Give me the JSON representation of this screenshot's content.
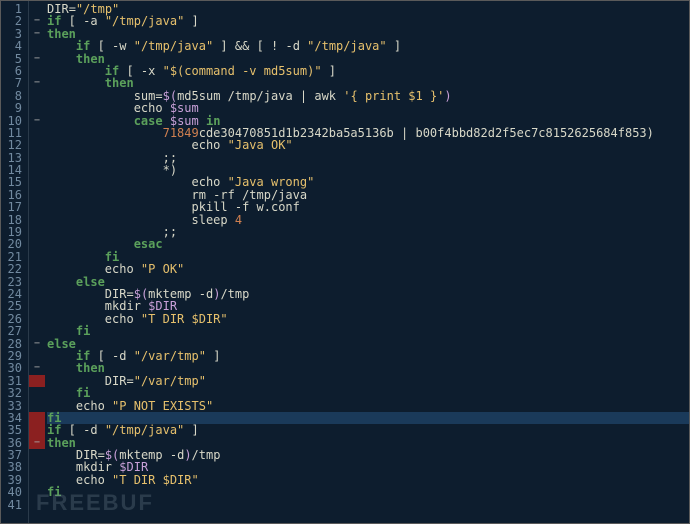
{
  "watermark": "FREEBUF",
  "lines": [
    {
      "n": 1,
      "f": "",
      "cls": "",
      "tokens": [
        {
          "c": "s-var",
          "t": "DIR"
        },
        {
          "c": "s-op",
          "t": "="
        },
        {
          "c": "s-str",
          "t": "\"/tmp\""
        }
      ]
    },
    {
      "n": 2,
      "f": "-",
      "cls": "",
      "tokens": [
        {
          "c": "s-greenkw",
          "t": "if"
        },
        {
          "c": "s-op",
          "t": " [ "
        },
        {
          "c": "s-op",
          "t": "-a "
        },
        {
          "c": "s-str",
          "t": "\"/tmp/java\""
        },
        {
          "c": "s-op",
          "t": " ]"
        }
      ]
    },
    {
      "n": 3,
      "f": "-",
      "cls": "",
      "tokens": [
        {
          "c": "s-greenkw",
          "t": "then"
        }
      ]
    },
    {
      "n": 4,
      "f": "",
      "cls": "",
      "tokens": [
        {
          "c": "s-op",
          "t": "    "
        },
        {
          "c": "s-greenkw",
          "t": "if"
        },
        {
          "c": "s-op",
          "t": " [ -w "
        },
        {
          "c": "s-str",
          "t": "\"/tmp/java\""
        },
        {
          "c": "s-op",
          "t": " ] "
        },
        {
          "c": "s-op",
          "t": "&& "
        },
        {
          "c": "s-op",
          "t": "[ ! -d "
        },
        {
          "c": "s-str",
          "t": "\"/tmp/java\""
        },
        {
          "c": "s-op",
          "t": " ]"
        }
      ]
    },
    {
      "n": 5,
      "f": "-",
      "cls": "",
      "tokens": [
        {
          "c": "s-op",
          "t": "    "
        },
        {
          "c": "s-greenkw",
          "t": "then"
        }
      ]
    },
    {
      "n": 6,
      "f": "",
      "cls": "",
      "tokens": [
        {
          "c": "s-op",
          "t": "        "
        },
        {
          "c": "s-greenkw",
          "t": "if"
        },
        {
          "c": "s-op",
          "t": " [ -x "
        },
        {
          "c": "s-str",
          "t": "\"$(command -v md5sum)\""
        },
        {
          "c": "s-op",
          "t": " ]"
        }
      ]
    },
    {
      "n": 7,
      "f": "-",
      "cls": "",
      "tokens": [
        {
          "c": "s-op",
          "t": "        "
        },
        {
          "c": "s-greenkw",
          "t": "then"
        }
      ]
    },
    {
      "n": 8,
      "f": "",
      "cls": "",
      "tokens": [
        {
          "c": "s-op",
          "t": "            "
        },
        {
          "c": "s-var",
          "t": "sum"
        },
        {
          "c": "s-op",
          "t": "="
        },
        {
          "c": "s-dollar",
          "t": "$("
        },
        {
          "c": "s-cmd",
          "t": "md5sum /tmp/java "
        },
        {
          "c": "s-op",
          "t": "| "
        },
        {
          "c": "s-cmd",
          "t": "awk "
        },
        {
          "c": "s-str",
          "t": "'{ print $1 }'"
        },
        {
          "c": "s-dollar",
          "t": ")"
        }
      ]
    },
    {
      "n": 9,
      "f": "",
      "cls": "",
      "tokens": [
        {
          "c": "s-op",
          "t": "            "
        },
        {
          "c": "s-cmd",
          "t": "echo "
        },
        {
          "c": "s-dollar",
          "t": "$sum"
        }
      ]
    },
    {
      "n": 10,
      "f": "-",
      "cls": "",
      "tokens": [
        {
          "c": "s-op",
          "t": "            "
        },
        {
          "c": "s-greenkw",
          "t": "case"
        },
        {
          "c": "s-op",
          "t": " "
        },
        {
          "c": "s-dollar",
          "t": "$sum"
        },
        {
          "c": "s-op",
          "t": " "
        },
        {
          "c": "s-greenkw",
          "t": "in"
        }
      ]
    },
    {
      "n": 11,
      "f": "",
      "cls": "",
      "tokens": [
        {
          "c": "s-op",
          "t": "                "
        },
        {
          "c": "s-num",
          "t": "71849"
        },
        {
          "c": "s-var",
          "t": "cde30470851d1b2342ba5a5136b "
        },
        {
          "c": "s-op",
          "t": "| "
        },
        {
          "c": "s-var",
          "t": "b00f4bbd82d2f5ec7c8152625684f853"
        },
        {
          "c": "s-op",
          "t": ")"
        }
      ]
    },
    {
      "n": 12,
      "f": "",
      "cls": "",
      "tokens": [
        {
          "c": "s-op",
          "t": "                    "
        },
        {
          "c": "s-cmd",
          "t": "echo "
        },
        {
          "c": "s-str",
          "t": "\"Java OK\""
        }
      ]
    },
    {
      "n": 13,
      "f": "",
      "cls": "",
      "tokens": [
        {
          "c": "s-op",
          "t": "                "
        },
        {
          "c": "s-op",
          "t": ";;"
        }
      ]
    },
    {
      "n": 14,
      "f": "",
      "cls": "",
      "tokens": [
        {
          "c": "s-op",
          "t": "                "
        },
        {
          "c": "s-op",
          "t": "*)"
        }
      ]
    },
    {
      "n": 15,
      "f": "",
      "cls": "",
      "tokens": [
        {
          "c": "s-op",
          "t": "                    "
        },
        {
          "c": "s-cmd",
          "t": "echo "
        },
        {
          "c": "s-str",
          "t": "\"Java wrong\""
        }
      ]
    },
    {
      "n": 16,
      "f": "",
      "cls": "",
      "tokens": [
        {
          "c": "s-op",
          "t": "                    "
        },
        {
          "c": "s-cmd",
          "t": "rm -rf /tmp/java"
        }
      ]
    },
    {
      "n": 17,
      "f": "",
      "cls": "",
      "tokens": [
        {
          "c": "s-op",
          "t": "                    "
        },
        {
          "c": "s-cmd",
          "t": "pkill -f w.conf"
        }
      ]
    },
    {
      "n": 18,
      "f": "",
      "cls": "",
      "tokens": [
        {
          "c": "s-op",
          "t": "                    "
        },
        {
          "c": "s-cmd",
          "t": "sleep "
        },
        {
          "c": "s-num",
          "t": "4"
        }
      ]
    },
    {
      "n": 19,
      "f": "",
      "cls": "",
      "tokens": [
        {
          "c": "s-op",
          "t": "                "
        },
        {
          "c": "s-op",
          "t": ";;"
        }
      ]
    },
    {
      "n": 20,
      "f": "",
      "cls": "",
      "tokens": [
        {
          "c": "s-op",
          "t": "            "
        },
        {
          "c": "s-greenkw",
          "t": "esac"
        }
      ]
    },
    {
      "n": 21,
      "f": "",
      "cls": "",
      "tokens": [
        {
          "c": "s-op",
          "t": "        "
        },
        {
          "c": "s-greenkw",
          "t": "fi"
        }
      ]
    },
    {
      "n": 22,
      "f": "",
      "cls": "",
      "tokens": [
        {
          "c": "s-op",
          "t": "        "
        },
        {
          "c": "s-cmd",
          "t": "echo "
        },
        {
          "c": "s-str",
          "t": "\"P OK\""
        }
      ]
    },
    {
      "n": 23,
      "f": "",
      "cls": "",
      "tokens": [
        {
          "c": "s-op",
          "t": "    "
        },
        {
          "c": "s-greenkw",
          "t": "else"
        }
      ]
    },
    {
      "n": 24,
      "f": "",
      "cls": "",
      "tokens": [
        {
          "c": "s-op",
          "t": "        "
        },
        {
          "c": "s-var",
          "t": "DIR"
        },
        {
          "c": "s-op",
          "t": "="
        },
        {
          "c": "s-dollar",
          "t": "$("
        },
        {
          "c": "s-cmd",
          "t": "mktemp -d"
        },
        {
          "c": "s-dollar",
          "t": ")"
        },
        {
          "c": "s-cmd",
          "t": "/tmp"
        }
      ]
    },
    {
      "n": 25,
      "f": "",
      "cls": "",
      "tokens": [
        {
          "c": "s-op",
          "t": "        "
        },
        {
          "c": "s-cmd",
          "t": "mkdir "
        },
        {
          "c": "s-dollar",
          "t": "$DIR"
        }
      ]
    },
    {
      "n": 26,
      "f": "",
      "cls": "",
      "tokens": [
        {
          "c": "s-op",
          "t": "        "
        },
        {
          "c": "s-cmd",
          "t": "echo "
        },
        {
          "c": "s-str",
          "t": "\"T DIR $DIR\""
        }
      ]
    },
    {
      "n": 27,
      "f": "",
      "cls": "",
      "tokens": [
        {
          "c": "s-op",
          "t": "    "
        },
        {
          "c": "s-greenkw",
          "t": "fi"
        }
      ]
    },
    {
      "n": 28,
      "f": "-",
      "cls": "",
      "tokens": [
        {
          "c": "s-greenkw",
          "t": "else"
        }
      ]
    },
    {
      "n": 29,
      "f": "",
      "cls": "",
      "tokens": [
        {
          "c": "s-op",
          "t": "    "
        },
        {
          "c": "s-greenkw",
          "t": "if"
        },
        {
          "c": "s-op",
          "t": " [ -d "
        },
        {
          "c": "s-str",
          "t": "\"/var/tmp\""
        },
        {
          "c": "s-op",
          "t": " ]"
        }
      ]
    },
    {
      "n": 30,
      "f": "-",
      "cls": "",
      "tokens": [
        {
          "c": "s-op",
          "t": "    "
        },
        {
          "c": "s-greenkw",
          "t": "then"
        }
      ]
    },
    {
      "n": 31,
      "f": "r",
      "cls": "",
      "tokens": [
        {
          "c": "s-op",
          "t": "        "
        },
        {
          "c": "s-var",
          "t": "DIR"
        },
        {
          "c": "s-op",
          "t": "="
        },
        {
          "c": "s-str",
          "t": "\"/var/tmp\""
        }
      ]
    },
    {
      "n": 32,
      "f": "",
      "cls": "",
      "tokens": [
        {
          "c": "s-op",
          "t": "    "
        },
        {
          "c": "s-greenkw",
          "t": "fi"
        }
      ]
    },
    {
      "n": 33,
      "f": "",
      "cls": "",
      "tokens": [
        {
          "c": "s-op",
          "t": "    "
        },
        {
          "c": "s-cmd",
          "t": "echo "
        },
        {
          "c": "s-str",
          "t": "\"P NOT EXISTS\""
        }
      ]
    },
    {
      "n": 34,
      "f": "r",
      "cls": "hl",
      "tokens": [
        {
          "c": "s-greenkw",
          "t": "fi"
        }
      ]
    },
    {
      "n": 35,
      "f": "r",
      "cls": "",
      "tokens": [
        {
          "c": "s-greenkw",
          "t": "if"
        },
        {
          "c": "s-op",
          "t": " [ -d "
        },
        {
          "c": "s-str",
          "t": "\"/tmp/java\""
        },
        {
          "c": "s-op",
          "t": " ]"
        }
      ]
    },
    {
      "n": 36,
      "f": "-r",
      "cls": "",
      "tokens": [
        {
          "c": "s-greenkw",
          "t": "then"
        }
      ]
    },
    {
      "n": 37,
      "f": "",
      "cls": "",
      "tokens": [
        {
          "c": "s-op",
          "t": "    "
        },
        {
          "c": "s-var",
          "t": "DIR"
        },
        {
          "c": "s-op",
          "t": "="
        },
        {
          "c": "s-dollar",
          "t": "$("
        },
        {
          "c": "s-cmd",
          "t": "mktemp -d"
        },
        {
          "c": "s-dollar",
          "t": ")"
        },
        {
          "c": "s-cmd",
          "t": "/tmp"
        }
      ]
    },
    {
      "n": 38,
      "f": "",
      "cls": "",
      "tokens": [
        {
          "c": "s-op",
          "t": "    "
        },
        {
          "c": "s-cmd",
          "t": "mkdir "
        },
        {
          "c": "s-dollar",
          "t": "$DIR"
        }
      ]
    },
    {
      "n": 39,
      "f": "",
      "cls": "",
      "tokens": [
        {
          "c": "s-op",
          "t": "    "
        },
        {
          "c": "s-cmd",
          "t": "echo "
        },
        {
          "c": "s-str",
          "t": "\"T DIR $DIR\""
        }
      ]
    },
    {
      "n": 40,
      "f": "",
      "cls": "",
      "tokens": [
        {
          "c": "s-greenkw",
          "t": "fi"
        }
      ]
    },
    {
      "n": 41,
      "f": "",
      "cls": "",
      "tokens": []
    }
  ]
}
